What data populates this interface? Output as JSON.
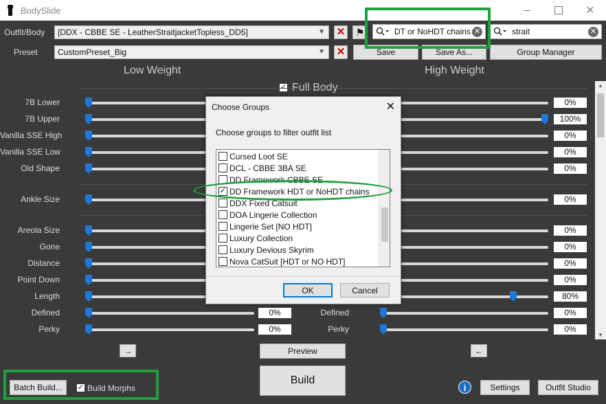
{
  "window": {
    "title": "BodySlide"
  },
  "outfit": {
    "label": "Outfit/Body",
    "value": "[DDX - CBBE SE - LeatherStraitjacketTopless_DD5]"
  },
  "preset": {
    "label": "Preset",
    "value": "CustomPreset_Big"
  },
  "group_filter": {
    "value": "DT or NoHDT chains"
  },
  "outfit_filter": {
    "value": "strait"
  },
  "toolbar": {
    "save_label": "Save",
    "save_as_label": "Save As...",
    "group_manager_label": "Group Manager"
  },
  "headings": {
    "low_weight": "Low Weight",
    "high_weight": "High Weight",
    "full_body": "Full Body"
  },
  "sliders": [
    {
      "name": "7B Lower",
      "low_value": "",
      "high_value": "0%",
      "high_level": 0
    },
    {
      "name": "7B Upper",
      "low_value": "",
      "high_value": "100%",
      "high_level": 100
    },
    {
      "name": "Vanilla SSE High",
      "low_value": "",
      "high_value": "0%",
      "high_level": 0
    },
    {
      "name": "Vanilla SSE Low",
      "low_value": "",
      "high_value": "0%",
      "high_level": 0
    },
    {
      "name": "Old Shape",
      "low_value": "",
      "high_value": "0%",
      "high_level": 0
    },
    {
      "name": "Ankle Size",
      "low_value": "",
      "high_value": "0%",
      "high_level": 0
    },
    {
      "name": "Areola Size",
      "low_value": "",
      "high_value": "0%",
      "high_level": 0
    },
    {
      "name": "Gone",
      "low_value": "",
      "high_value": "0%",
      "high_level": 0
    },
    {
      "name": "Distance",
      "low_value": "",
      "high_value": "0%",
      "high_level": 0
    },
    {
      "name": "Point Down",
      "low_value": "",
      "high_value": "0%",
      "high_level": 0
    },
    {
      "name": "Length",
      "low_value": "",
      "high_value": "80%",
      "high_level": 80
    },
    {
      "name": "Defined",
      "low_value": "0%",
      "high_value": "0%",
      "high_level": 0,
      "high_name": "Defined"
    },
    {
      "name": "Perky",
      "low_value": "0%",
      "high_value": "0%",
      "high_level": 0,
      "high_name": "Perky"
    }
  ],
  "bottom": {
    "copy_right_label": "→",
    "copy_left_label": "←",
    "preview_label": "Preview",
    "build_label": "Build",
    "batch_build_label": "Batch Build...",
    "build_morphs_label": "Build Morphs",
    "info_label": "i",
    "settings_label": "Settings",
    "outfit_studio_label": "Outfit Studio"
  },
  "dialog": {
    "title": "Choose Groups",
    "close": "✕",
    "prompt": "Choose groups to filter outfit list",
    "items": [
      {
        "label": "Cursed Loot SE",
        "checked": false
      },
      {
        "label": "DCL - CBBE 3BA SE",
        "checked": false
      },
      {
        "label": "DD Framework CBBE SE",
        "checked": false
      },
      {
        "label": "DD Framework HDT or NoHDT chains",
        "checked": true
      },
      {
        "label": "DDX Fixed Catsuit",
        "checked": false
      },
      {
        "label": "DOA Lingerie Collection",
        "checked": false
      },
      {
        "label": "Lingerie Set [NO HDT]",
        "checked": false
      },
      {
        "label": "Luxury Collection",
        "checked": false
      },
      {
        "label": "Luxury Devious Skyrim",
        "checked": false
      },
      {
        "label": "Nova CatSuit [HDT or NO HDT]",
        "checked": false
      }
    ],
    "ok_label": "OK",
    "cancel_label": "Cancel"
  },
  "colors": {
    "background": "#3a3a3a",
    "slider_thumb": "#1e78d8",
    "annotation": "#20a040",
    "remove_x": "#cc0000"
  }
}
